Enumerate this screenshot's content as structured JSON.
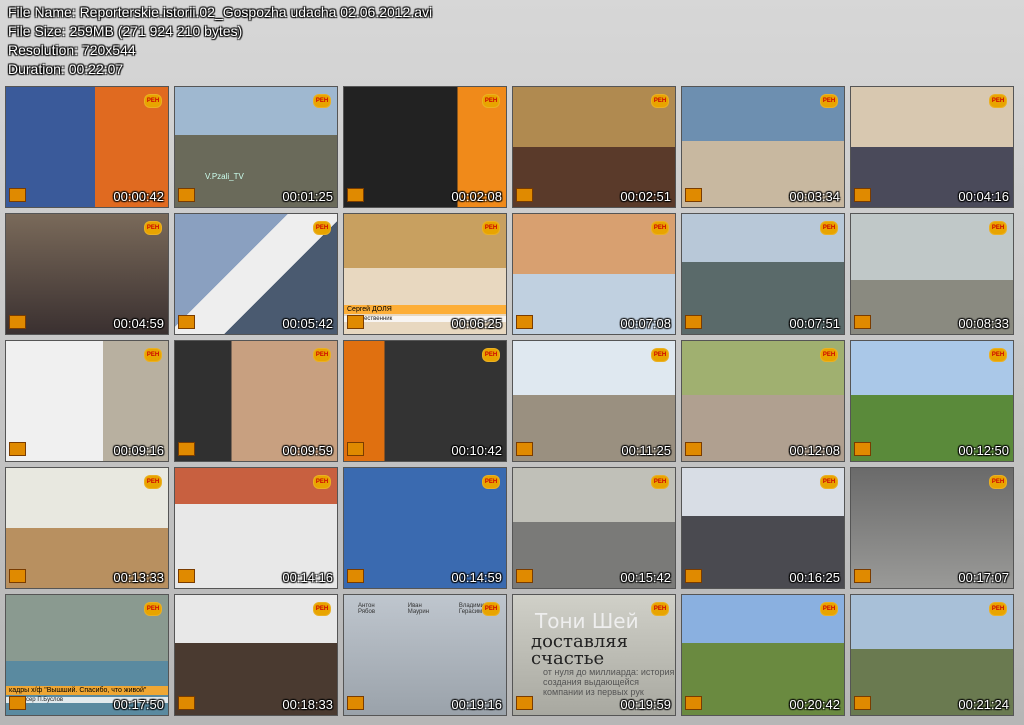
{
  "file_info": {
    "name_line": "File Name: Reporterskie.istorii.02_Gospozha udacha 02.06.2012.avi",
    "size_line": "File Size: 259MB (271 924 210 bytes)",
    "resolution_line": "Resolution: 720x544",
    "duration_line": "Duration: 00:22:07"
  },
  "channel_logo": "РЕН",
  "thumbnails": [
    {
      "time": "00:00:42"
    },
    {
      "time": "00:01:25",
      "watermark": "V.Pzali_TV"
    },
    {
      "time": "00:02:08"
    },
    {
      "time": "00:02:51"
    },
    {
      "time": "00:03:34"
    },
    {
      "time": "00:04:16"
    },
    {
      "time": "00:04:59"
    },
    {
      "time": "00:05:42"
    },
    {
      "time": "00:06:25",
      "caption": "Сергей ДОЛЯ",
      "caption2": "путешественник"
    },
    {
      "time": "00:07:08"
    },
    {
      "time": "00:07:51"
    },
    {
      "time": "00:08:33"
    },
    {
      "time": "00:09:16"
    },
    {
      "time": "00:09:59"
    },
    {
      "time": "00:10:42"
    },
    {
      "time": "00:11:25"
    },
    {
      "time": "00:12:08"
    },
    {
      "time": "00:12:50"
    },
    {
      "time": "00:13:33"
    },
    {
      "time": "00:14:16"
    },
    {
      "time": "00:14:59"
    },
    {
      "time": "00:15:42"
    },
    {
      "time": "00:16:25"
    },
    {
      "time": "00:17:07"
    },
    {
      "time": "00:17:50",
      "caption": "кадры х/ф \"Вышший. Спасибо, что живой\"",
      "caption2": "режиссер П.Буслов"
    },
    {
      "time": "00:18:33"
    },
    {
      "time": "00:19:16",
      "names": [
        "Антон Рябов",
        "Иван Маурин",
        "Владимир Герасимов"
      ]
    },
    {
      "time": "00:19:59",
      "book_title": "Тони Шей",
      "book_big": "доставляя счастье",
      "book_sub": "от нуля до миллиарда: история создания выдающейся компании из первых рук"
    },
    {
      "time": "00:20:42"
    },
    {
      "time": "00:21:24"
    }
  ]
}
